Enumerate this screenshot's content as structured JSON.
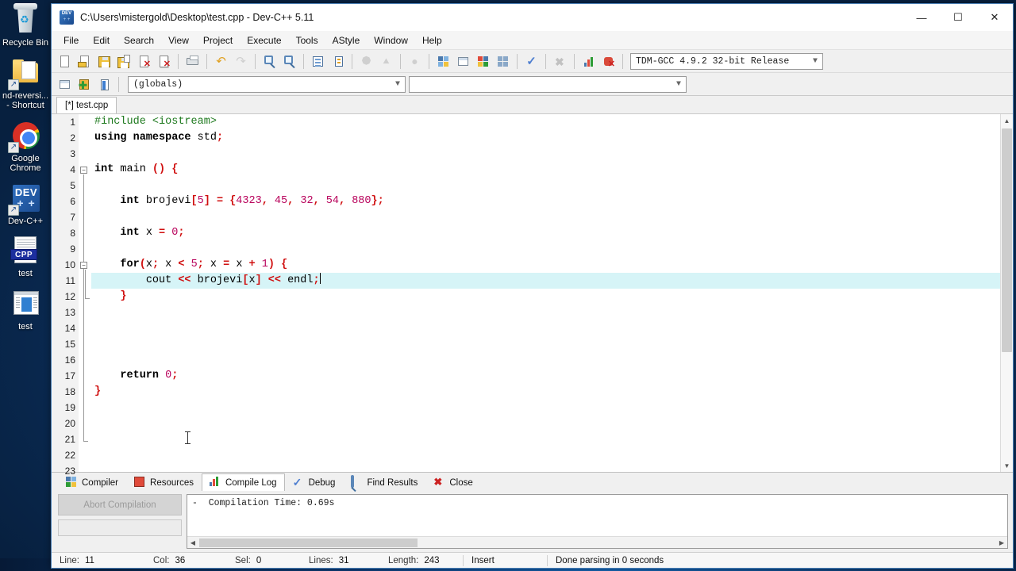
{
  "desktop": {
    "icons": [
      {
        "name": "recycle-bin",
        "label": "Recycle Bin"
      },
      {
        "name": "folder-shortcut",
        "label": "nd-reversi...\n- Shortcut"
      },
      {
        "name": "google-chrome",
        "label": "Google\nChrome"
      },
      {
        "name": "dev-cpp-shortcut",
        "label": "Dev-C++"
      },
      {
        "name": "cpp-source-file",
        "label": "test"
      },
      {
        "name": "executable-file",
        "label": "test"
      }
    ]
  },
  "window": {
    "title": "C:\\Users\\mistergold\\Desktop\\test.cpp - Dev-C++ 5.11",
    "minimize": "—",
    "maximize": "☐",
    "close": "✕"
  },
  "menu": {
    "items": [
      "File",
      "Edit",
      "Search",
      "View",
      "Project",
      "Execute",
      "Tools",
      "AStyle",
      "Window",
      "Help"
    ]
  },
  "toolbar": {
    "row1": [
      {
        "name": "new-file-button",
        "icon": "page-icon"
      },
      {
        "name": "open-file-button",
        "icon": "open-folder-icon"
      },
      {
        "name": "save-button",
        "icon": "floppy-icon"
      },
      {
        "name": "save-all-button",
        "icon": "floppy-multiple-icon"
      },
      {
        "name": "close-file-button",
        "icon": "page-close-icon"
      },
      {
        "name": "close-all-button",
        "icon": "pages-close-icon"
      },
      {
        "name": "print-button",
        "icon": "printer-icon"
      },
      {
        "name": "undo-button",
        "icon": "undo-arrow-icon"
      },
      {
        "name": "redo-button",
        "icon": "redo-arrow-icon"
      },
      {
        "name": "find-button",
        "icon": "magnifier-icon"
      },
      {
        "name": "replace-button",
        "icon": "magnifier-replace-icon"
      },
      {
        "name": "goto-line-button",
        "icon": "lines-icon"
      },
      {
        "name": "goto-function-button",
        "icon": "indent-icon"
      },
      {
        "name": "back-button",
        "icon": "left-pentagon-icon"
      },
      {
        "name": "forward-button",
        "icon": "right-pentagon-icon"
      },
      {
        "name": "toggle-bookmark-button",
        "icon": "bookmark-icon"
      },
      {
        "name": "compile-button",
        "icon": "grid-compile-icon"
      },
      {
        "name": "run-button",
        "icon": "window-run-icon"
      },
      {
        "name": "compile-run-button",
        "icon": "grid-run-icon"
      },
      {
        "name": "rebuild-all-button",
        "icon": "grid-rebuild-icon"
      },
      {
        "name": "syntax-check-button",
        "icon": "checkmark-icon"
      },
      {
        "name": "stop-execution-button",
        "icon": "stop-x-icon"
      },
      {
        "name": "profile-button",
        "icon": "bar-chart-icon"
      },
      {
        "name": "delete-profile-button",
        "icon": "bug-delete-icon"
      }
    ],
    "row2": [
      {
        "name": "insert-template-button",
        "icon": "window-insert-icon"
      },
      {
        "name": "add-to-project-button",
        "icon": "folder-plus-icon"
      },
      {
        "name": "toggle-panel-button",
        "icon": "book-icon"
      }
    ],
    "compiler_select": "TDM-GCC 4.9.2 32-bit Release",
    "scope_select": "(globals)",
    "member_select": ""
  },
  "editor": {
    "tab_label": "[*] test.cpp",
    "first_line": 1,
    "last_visible_line": 23,
    "cursor_line": 11,
    "lines": [
      {
        "n": 1,
        "tokens": [
          {
            "t": "#include ",
            "c": "pp"
          },
          {
            "t": "<iostream>",
            "c": "pp"
          }
        ]
      },
      {
        "n": 2,
        "tokens": [
          {
            "t": "using namespace ",
            "c": "kw"
          },
          {
            "t": "std",
            "c": "plain"
          },
          {
            "t": ";",
            "c": "punct"
          }
        ]
      },
      {
        "n": 3,
        "tokens": []
      },
      {
        "n": 4,
        "tokens": [
          {
            "t": "int ",
            "c": "kw"
          },
          {
            "t": "main ",
            "c": "plain"
          },
          {
            "t": "()",
            "c": "punct"
          },
          {
            "t": " ",
            "c": "plain"
          },
          {
            "t": "{",
            "c": "punct"
          }
        ]
      },
      {
        "n": 5,
        "tokens": []
      },
      {
        "n": 6,
        "tokens": [
          {
            "t": "    ",
            "c": "plain"
          },
          {
            "t": "int ",
            "c": "kw"
          },
          {
            "t": "brojevi",
            "c": "plain"
          },
          {
            "t": "[",
            "c": "punct"
          },
          {
            "t": "5",
            "c": "num"
          },
          {
            "t": "]",
            "c": "punct"
          },
          {
            "t": " ",
            "c": "plain"
          },
          {
            "t": "=",
            "c": "op"
          },
          {
            "t": " ",
            "c": "plain"
          },
          {
            "t": "{",
            "c": "punct"
          },
          {
            "t": "4323",
            "c": "num"
          },
          {
            "t": ",",
            "c": "punct"
          },
          {
            "t": " ",
            "c": "plain"
          },
          {
            "t": "45",
            "c": "num"
          },
          {
            "t": ",",
            "c": "punct"
          },
          {
            "t": " ",
            "c": "plain"
          },
          {
            "t": "32",
            "c": "num"
          },
          {
            "t": ",",
            "c": "punct"
          },
          {
            "t": " ",
            "c": "plain"
          },
          {
            "t": "54",
            "c": "num"
          },
          {
            "t": ",",
            "c": "punct"
          },
          {
            "t": " ",
            "c": "plain"
          },
          {
            "t": "880",
            "c": "num"
          },
          {
            "t": "}",
            "c": "punct"
          },
          {
            "t": ";",
            "c": "punct"
          }
        ]
      },
      {
        "n": 7,
        "tokens": []
      },
      {
        "n": 8,
        "tokens": [
          {
            "t": "    ",
            "c": "plain"
          },
          {
            "t": "int ",
            "c": "kw"
          },
          {
            "t": "x ",
            "c": "plain"
          },
          {
            "t": "=",
            "c": "op"
          },
          {
            "t": " ",
            "c": "plain"
          },
          {
            "t": "0",
            "c": "num"
          },
          {
            "t": ";",
            "c": "punct"
          }
        ]
      },
      {
        "n": 9,
        "tokens": []
      },
      {
        "n": 10,
        "tokens": [
          {
            "t": "    ",
            "c": "plain"
          },
          {
            "t": "for",
            "c": "kw"
          },
          {
            "t": "(",
            "c": "punct"
          },
          {
            "t": "x",
            "c": "plain"
          },
          {
            "t": ";",
            "c": "punct"
          },
          {
            "t": " x ",
            "c": "plain"
          },
          {
            "t": "<",
            "c": "op"
          },
          {
            "t": " ",
            "c": "plain"
          },
          {
            "t": "5",
            "c": "num"
          },
          {
            "t": ";",
            "c": "punct"
          },
          {
            "t": " x ",
            "c": "plain"
          },
          {
            "t": "=",
            "c": "op"
          },
          {
            "t": " x ",
            "c": "plain"
          },
          {
            "t": "+",
            "c": "op"
          },
          {
            "t": " ",
            "c": "plain"
          },
          {
            "t": "1",
            "c": "num"
          },
          {
            "t": ")",
            "c": "punct"
          },
          {
            "t": " ",
            "c": "plain"
          },
          {
            "t": "{",
            "c": "punct"
          }
        ]
      },
      {
        "n": 11,
        "tokens": [
          {
            "t": "        ",
            "c": "plain"
          },
          {
            "t": "cout ",
            "c": "plain"
          },
          {
            "t": "<<",
            "c": "op"
          },
          {
            "t": " brojevi",
            "c": "plain"
          },
          {
            "t": "[",
            "c": "punct"
          },
          {
            "t": "x",
            "c": "plain"
          },
          {
            "t": "]",
            "c": "punct"
          },
          {
            "t": " ",
            "c": "plain"
          },
          {
            "t": "<<",
            "c": "op"
          },
          {
            "t": " endl",
            "c": "plain"
          },
          {
            "t": ";",
            "c": "punct"
          }
        ],
        "highlight": true,
        "caret": true
      },
      {
        "n": 12,
        "tokens": [
          {
            "t": "    ",
            "c": "plain"
          },
          {
            "t": "}",
            "c": "punct"
          }
        ]
      },
      {
        "n": 13,
        "tokens": []
      },
      {
        "n": 14,
        "tokens": []
      },
      {
        "n": 15,
        "tokens": []
      },
      {
        "n": 16,
        "tokens": []
      },
      {
        "n": 17,
        "tokens": [
          {
            "t": "    ",
            "c": "plain"
          },
          {
            "t": "return ",
            "c": "kw"
          },
          {
            "t": "0",
            "c": "num"
          },
          {
            "t": ";",
            "c": "punct"
          }
        ]
      },
      {
        "n": 18,
        "tokens": [
          {
            "t": "}",
            "c": "punct"
          }
        ]
      },
      {
        "n": 19,
        "tokens": []
      },
      {
        "n": 20,
        "tokens": []
      },
      {
        "n": 21,
        "tokens": []
      },
      {
        "n": 22,
        "tokens": []
      },
      {
        "n": 23,
        "tokens": []
      }
    ]
  },
  "panel": {
    "tabs": [
      {
        "label": "Compiler",
        "icon": "grid-icon",
        "active": false
      },
      {
        "label": "Resources",
        "icon": "resources-icon",
        "active": false
      },
      {
        "label": "Compile Log",
        "icon": "bar-chart-icon",
        "active": true
      },
      {
        "label": "Debug",
        "icon": "checkmark-icon",
        "active": false
      },
      {
        "label": "Find Results",
        "icon": "magnifier-icon",
        "active": false
      },
      {
        "label": "Close",
        "icon": "red-x-icon",
        "active": false
      }
    ],
    "abort_button": "Abort Compilation",
    "log_text": "-  Compilation Time: 0.69s"
  },
  "statusbar": {
    "fields": [
      {
        "label": "Line:",
        "value": "11"
      },
      {
        "label": "Col:",
        "value": "36"
      },
      {
        "label": "Sel:",
        "value": "0"
      },
      {
        "label": "Lines:",
        "value": "31"
      },
      {
        "label": "Length:",
        "value": "243"
      }
    ],
    "mode": "Insert",
    "message": "Done parsing in 0 seconds"
  }
}
